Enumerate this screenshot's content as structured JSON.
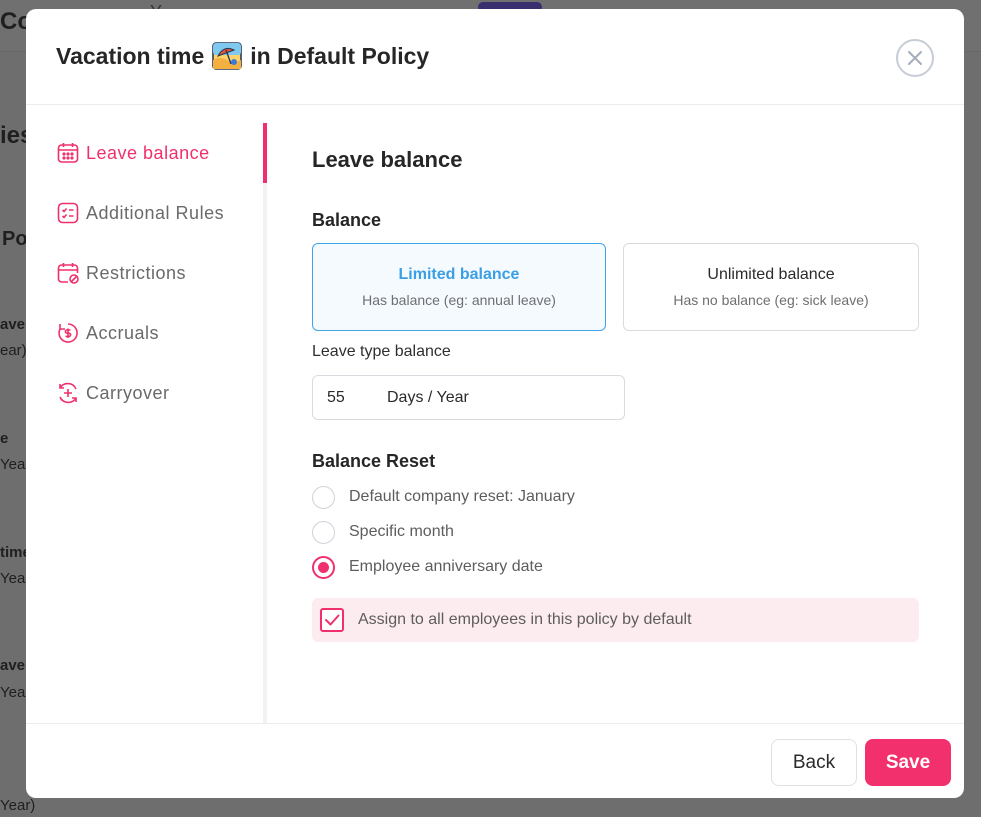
{
  "background": {
    "topbar_left": "Co",
    "topbar_middle": "Y",
    "heading_fragment": "ies",
    "policy_fragment": "Po",
    "rows": [
      {
        "title": "ave",
        "sub": "ear)"
      },
      {
        "title": "e",
        "sub": "Year"
      },
      {
        "title": "time",
        "sub": "Year"
      },
      {
        "title": "ave",
        "sub": "Year"
      },
      {
        "title": "",
        "sub": "Year)"
      }
    ]
  },
  "modal": {
    "title_prefix": "Vacation time",
    "title_suffix": "in Default Policy",
    "title_icon": "beach-umbrella-icon"
  },
  "sidebar": {
    "items": [
      {
        "label": "Leave balance",
        "icon": "calendar-icon",
        "active": true
      },
      {
        "label": "Additional Rules",
        "icon": "checklist-icon",
        "active": false
      },
      {
        "label": "Restrictions",
        "icon": "calendar-block-icon",
        "active": false
      },
      {
        "label": "Accruals",
        "icon": "dollar-cycle-icon",
        "active": false
      },
      {
        "label": "Carryover",
        "icon": "plus-cycle-icon",
        "active": false
      }
    ]
  },
  "content": {
    "section_title": "Leave balance",
    "balance_heading": "Balance",
    "cards": [
      {
        "title": "Limited balance",
        "subtitle": "Has balance (eg: annual leave)",
        "selected": true
      },
      {
        "title": "Unlimited balance",
        "subtitle": "Has no balance (eg: sick leave)",
        "selected": false
      }
    ],
    "leave_type_balance_label": "Leave type balance",
    "balance_value": "55",
    "balance_unit": "Days / Year",
    "reset_heading": "Balance Reset",
    "reset_options": [
      {
        "label": "Default company reset: January",
        "selected": false
      },
      {
        "label": "Specific month",
        "selected": false
      },
      {
        "label": "Employee anniversary date",
        "selected": true
      }
    ],
    "assign_label": "Assign to all employees in this policy by default",
    "assign_checked": true
  },
  "footer": {
    "back_label": "Back",
    "save_label": "Save"
  },
  "colors": {
    "accent": "#f0306d",
    "selected_card": "#3a9fe4",
    "assign_bg": "#fdecef"
  }
}
